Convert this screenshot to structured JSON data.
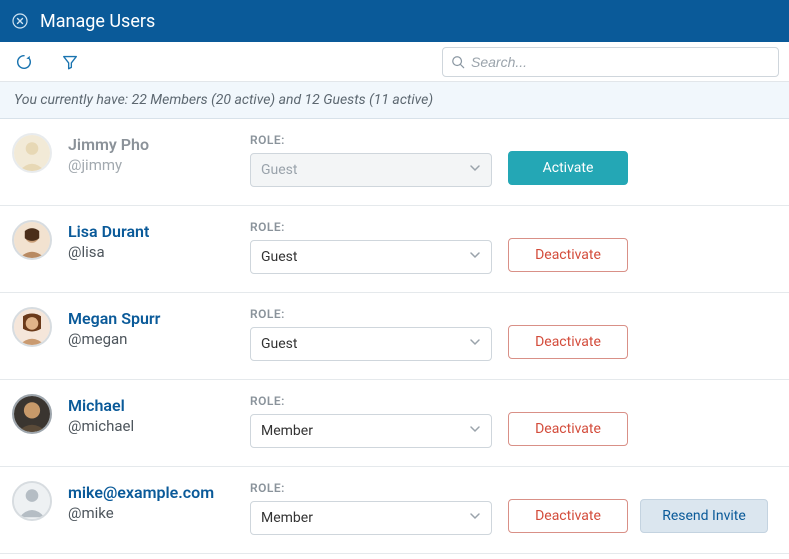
{
  "header": {
    "title": "Manage Users"
  },
  "search": {
    "placeholder": "Search..."
  },
  "summary": "You currently have: 22 Members (20 active) and 12 Guests (11 active)",
  "role_label": "ROLE:",
  "buttons": {
    "activate": "Activate",
    "deactivate": "Deactivate",
    "resend": "Resend Invite"
  },
  "users": [
    {
      "name": "Jimmy Pho",
      "handle": "@jimmy",
      "role": "Guest",
      "status": "inactive",
      "avatar": "jimmy"
    },
    {
      "name": "Lisa Durant",
      "handle": "@lisa",
      "role": "Guest",
      "status": "active",
      "avatar": "lisa"
    },
    {
      "name": "Megan Spurr",
      "handle": "@megan",
      "role": "Guest",
      "status": "active",
      "avatar": "megan"
    },
    {
      "name": "Michael",
      "handle": "@michael",
      "role": "Member",
      "status": "active",
      "avatar": "michael"
    },
    {
      "name": "mike@example.com",
      "handle": "@mike",
      "role": "Member",
      "status": "active",
      "avatar": "placeholder",
      "resend": true
    }
  ]
}
